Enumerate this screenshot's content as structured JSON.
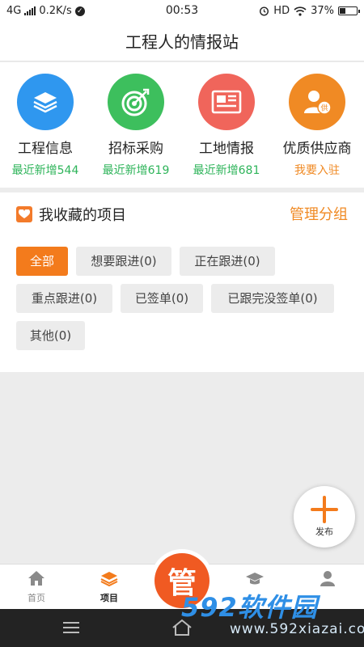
{
  "status_bar": {
    "network": "4G",
    "speed": "0.2K/s",
    "time": "00:53",
    "hd": "HD",
    "battery_percent": "37%",
    "battery_level": 0.37
  },
  "header": {
    "title": "工程人的情报站"
  },
  "categories": [
    {
      "name": "工程信息",
      "count": "最近新增544",
      "icon": "layers-icon",
      "color": "#2f97ef"
    },
    {
      "name": "招标采购",
      "count": "最近新增619",
      "icon": "target-icon",
      "color": "#3dbf5d"
    },
    {
      "name": "工地情报",
      "count": "最近新增681",
      "icon": "newspaper-icon",
      "color": "#f0655b"
    },
    {
      "name": "优质供应商",
      "count": "我要入驻",
      "icon": "supplier-icon",
      "color": "#f08a24"
    }
  ],
  "favorites": {
    "title": "我收藏的项目",
    "manage_label": "管理分组",
    "filters": [
      "全部",
      "想要跟进(0)",
      "正在跟进(0)",
      "重点跟进(0)",
      "已签单(0)",
      "已跟完没签单(0)",
      "其他(0)"
    ],
    "active_filter": "全部"
  },
  "fab": {
    "label": "发布"
  },
  "tabbar": {
    "items": [
      {
        "label": "首页",
        "icon": "home-icon"
      },
      {
        "label": "项目",
        "icon": "layers-icon"
      },
      {
        "label": "",
        "icon": "graduation-cap-icon"
      },
      {
        "label": "",
        "icon": "person-icon"
      }
    ],
    "active": "项目",
    "center_label": "管"
  },
  "watermark": {
    "big": "592软件园",
    "small": "www.592xiazai.com"
  },
  "colors": {
    "accent": "#f37b1c",
    "count_green": "#2eb45a",
    "count_orange": "#f08a24",
    "center_button": "#f05a22"
  }
}
